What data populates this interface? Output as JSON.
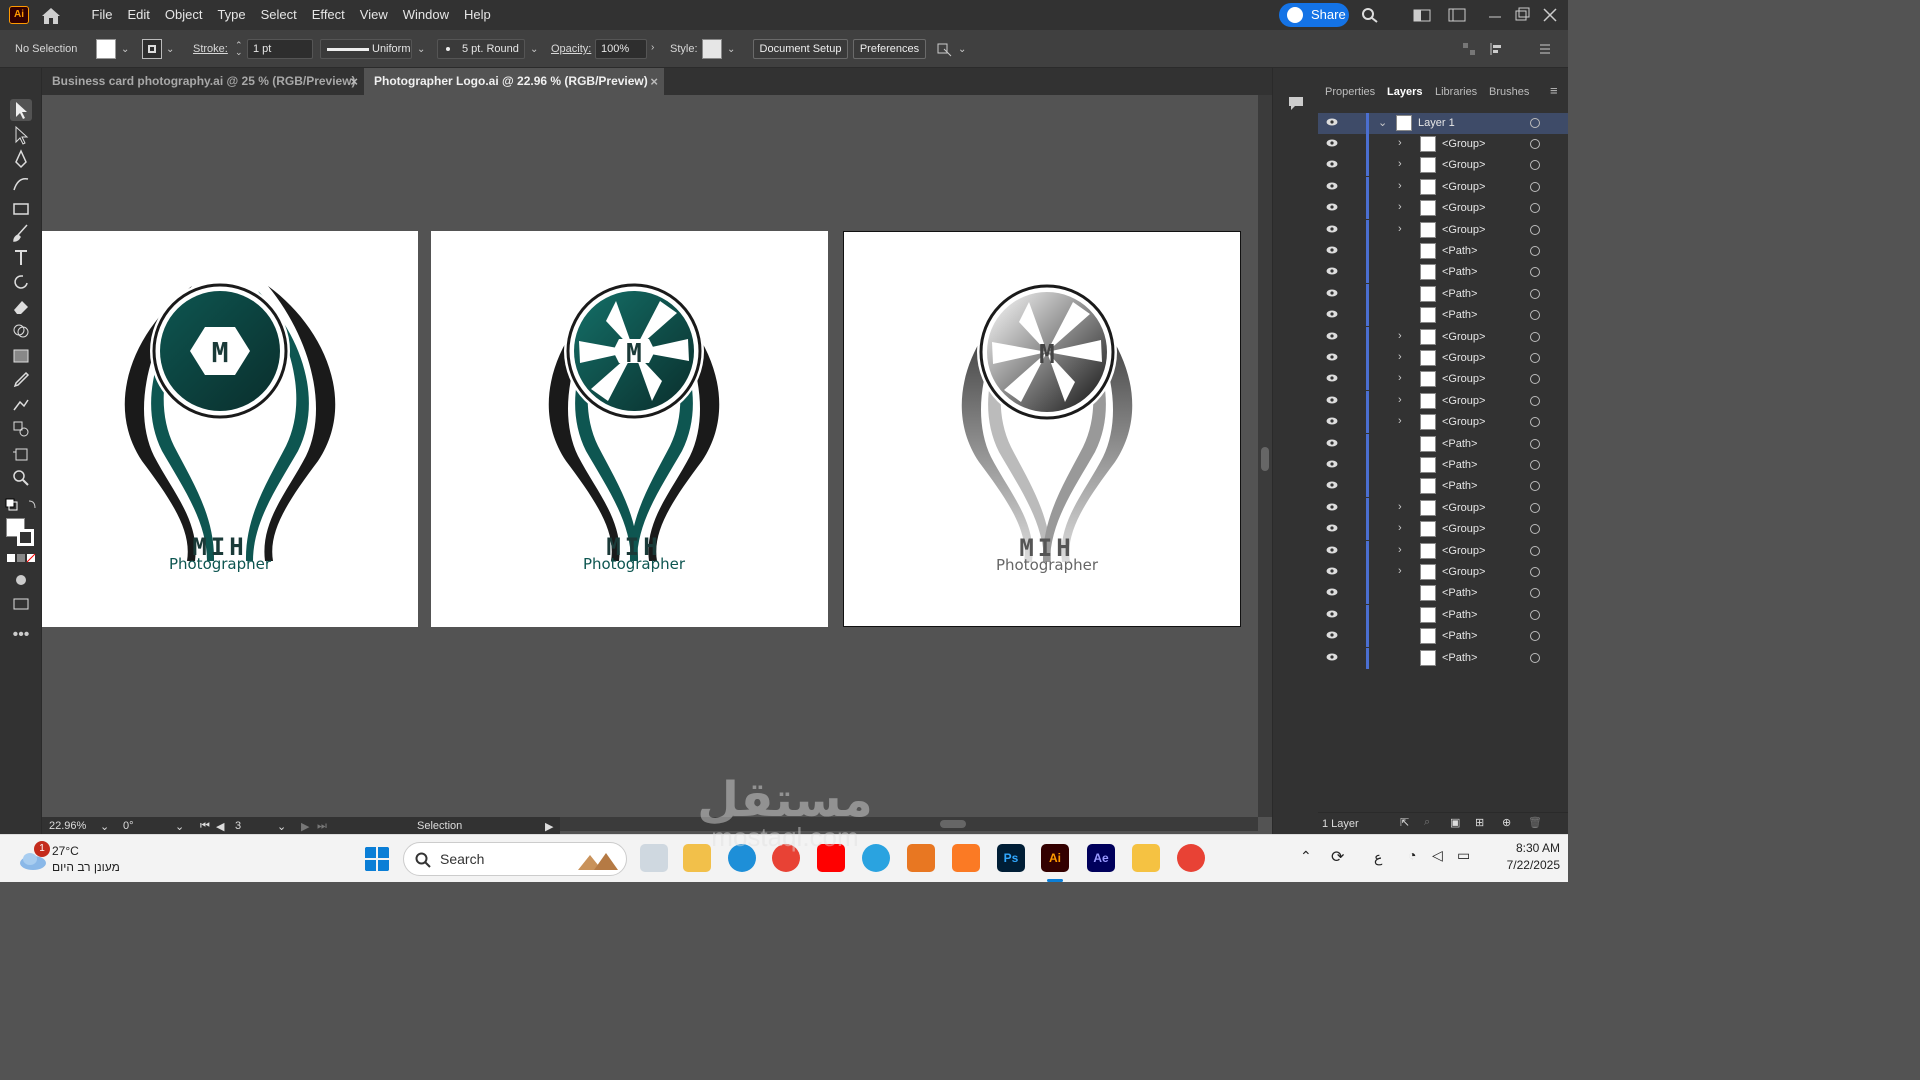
{
  "app": {
    "logo_text": "Ai"
  },
  "menu": [
    "File",
    "Edit",
    "Object",
    "Type",
    "Select",
    "Effect",
    "View",
    "Window",
    "Help"
  ],
  "share_label": "Share",
  "control": {
    "selection_label": "No Selection",
    "stroke_label": "Stroke:",
    "stroke_value": "1 pt",
    "stroke_profile": "Uniform",
    "brush": "5 pt. Round",
    "opacity_label": "Opacity:",
    "opacity_value": "100%",
    "style_label": "Style:",
    "document_setup": "Document Setup",
    "preferences": "Preferences"
  },
  "tabs": [
    {
      "label": "Business card photography.ai @ 25 % (RGB/Preview)",
      "active": false
    },
    {
      "label": "Photographer  Logo.ai @ 22.96 % (RGB/Preview)",
      "active": true
    }
  ],
  "artboards": [
    {
      "brand": "MIH",
      "tagline": "Photographer",
      "letter": "M",
      "style": "teal-hexagon"
    },
    {
      "brand": "MIH",
      "tagline": "Photographer",
      "letter": "M",
      "style": "teal-aperture"
    },
    {
      "brand": "MIH",
      "tagline": "Photographer",
      "letter": "M",
      "style": "grayscale-aperture"
    }
  ],
  "status": {
    "zoom": "22.96%",
    "rotation": "0°",
    "artboard_num": "3",
    "tool": "Selection"
  },
  "panel": {
    "tabs": [
      "Properties",
      "Layers",
      "Libraries",
      "Brushes"
    ],
    "active_tab": "Layers",
    "layer_name": "Layer 1",
    "items": [
      "<Group>",
      "<Group>",
      "<Group>",
      "<Group>",
      "<Group>",
      "<Path>",
      "<Path>",
      "<Path>",
      "<Path>",
      "<Group>",
      "<Group>",
      "<Group>",
      "<Group>",
      "<Group>",
      "<Path>",
      "<Path>",
      "<Path>",
      "<Group>",
      "<Group>",
      "<Group>",
      "<Group>",
      "<Path>",
      "<Path>",
      "<Path>",
      "<Path>"
    ],
    "footer": "1 Layer"
  },
  "taskbar": {
    "temp": "27°C",
    "weather_desc": "מעונן רב היום",
    "badge": "1",
    "search": "Search",
    "time": "8:30 AM",
    "date": "7/22/2025",
    "lang": "ع"
  },
  "watermark": {
    "ar": "مستقل",
    "latin": "mostaql.com"
  },
  "colors": {
    "teal": "#0e5651",
    "accent": "#1473e6"
  }
}
